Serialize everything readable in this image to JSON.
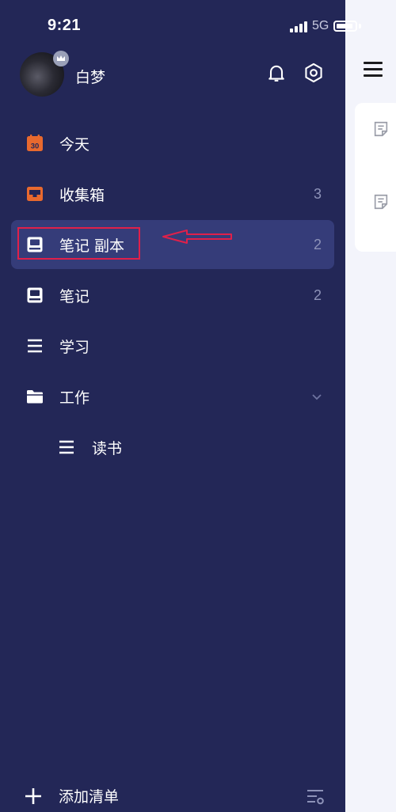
{
  "status_bar": {
    "time": "9:21",
    "network": "5G"
  },
  "profile": {
    "username": "白梦"
  },
  "nav": {
    "items": [
      {
        "label": "今天",
        "count": "",
        "calendar_day": "30"
      },
      {
        "label": "收集箱",
        "count": "3"
      },
      {
        "label": "笔记 副本",
        "count": "2"
      },
      {
        "label": "笔记",
        "count": "2"
      },
      {
        "label": "学习",
        "count": ""
      },
      {
        "label": "工作",
        "count": ""
      },
      {
        "label": "读书",
        "count": ""
      }
    ]
  },
  "footer": {
    "add_label": "添加清单"
  },
  "colors": {
    "drawer_bg": "#232757",
    "active_bg": "#353c79",
    "accent_orange": "#e8692e",
    "highlight_red": "#e0204a"
  }
}
